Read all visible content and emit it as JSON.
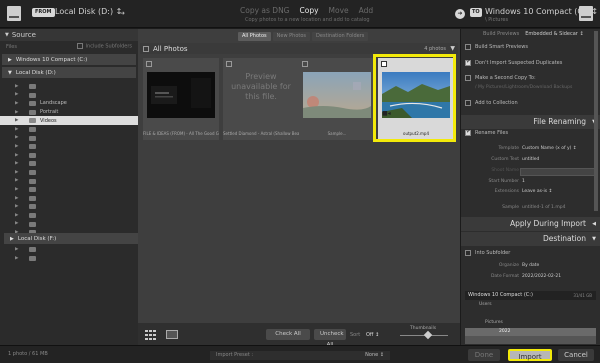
{
  "topbar": {
    "from_label": "FROM",
    "source_name": "Local Disk (D:) ↕",
    "modes": [
      "Copy as DNG",
      "Copy",
      "Move",
      "Add"
    ],
    "active_mode": "Copy",
    "mode_subtitle": "Copy photos to a new location and add to catalog",
    "to_label": "TO",
    "dest_name": "Windows 10 Compact (C:) ↕",
    "dest_subtitle": "\\ Pictures"
  },
  "source_panel": {
    "title": "Source",
    "files_label": "Files",
    "include_subfolders": "Include Subfolders",
    "volume1": "Windows 10 Compact (C:)",
    "volume2": "Local Disk (D:)",
    "folders": [
      "",
      "",
      "Landscape",
      "Portrait",
      "Videos",
      "",
      "",
      "",
      "",
      "",
      "",
      "",
      "",
      "",
      "",
      "",
      "",
      "",
      "",
      "",
      ""
    ],
    "selected_index": 4,
    "volume3": "Local Disk (F:)"
  },
  "center": {
    "tabs": [
      "All Photos",
      "New Photos",
      "Destination Folders"
    ],
    "active_tab": "All Photos",
    "grid_title": "All Photos",
    "photo_count": "4 photos",
    "cells": [
      {
        "filename": "FILE & IDEAS (FROM) - All The Good Gi..."
      },
      {
        "filename": "Settled Diamond - Astral (Shallow Beat)...",
        "preview_text": "Preview unavailable for this file."
      },
      {
        "filename": "Sample..."
      },
      {
        "filename": "output2.mp4"
      }
    ],
    "check_all": "Check All",
    "uncheck_all": "Uncheck All",
    "sort_label": "Sort",
    "sort_value": "Off ↕",
    "thumbnails_label": "Thumbnails"
  },
  "right_panel": {
    "build_previews_label": "Build Previews",
    "build_previews_value": "Embedded & Sidecar ↕",
    "build_smart": "Build Smart Previews",
    "dont_import": "Don't Import Suspected Duplicates",
    "second_copy": "Make a Second Copy To:",
    "second_copy_path": "/ My Pictures/Lightroom/Download Backups",
    "add_collection": "Add to Collection",
    "file_renaming": "File Renaming",
    "rename_files": "Rename Files",
    "template_label": "Template",
    "template_value": "Custom Name (x of y) ↕",
    "custom_text_label": "Custom Text",
    "custom_text_value": "untitled",
    "shoot_name_label": "Shoot Name",
    "start_number_label": "Start Number",
    "start_number_value": "1",
    "extensions_label": "Extensions",
    "extensions_value": "Leave as-is ↕",
    "sample_label": "Sample",
    "sample_value": "untitled-1 of 1.mp4",
    "apply_during_import": "Apply During Import",
    "destination": "Destination",
    "into_subfolder": "Into Subfolder",
    "organize_label": "Organize",
    "organize_value": "By date",
    "date_format_label": "Date Format",
    "date_format_value": "2022/2022-02-21",
    "dest_volume": "Windows 10 Compact (C:)",
    "dest_volume_info": "31/41 GB",
    "dest_tree": [
      "Users",
      "",
      "Pictures",
      "2022",
      "",
      ""
    ]
  },
  "statusbar": {
    "status": "1 photo / 61 MB",
    "import_preset_label": "Import Preset :",
    "import_preset_value": "None ↕",
    "done": "Done",
    "import": "Import",
    "cancel": "Cancel"
  },
  "colors": {
    "highlight": "#f3ea0a",
    "panel_bg": "#2b2b2b",
    "grid_bg": "#3e3e3e"
  }
}
